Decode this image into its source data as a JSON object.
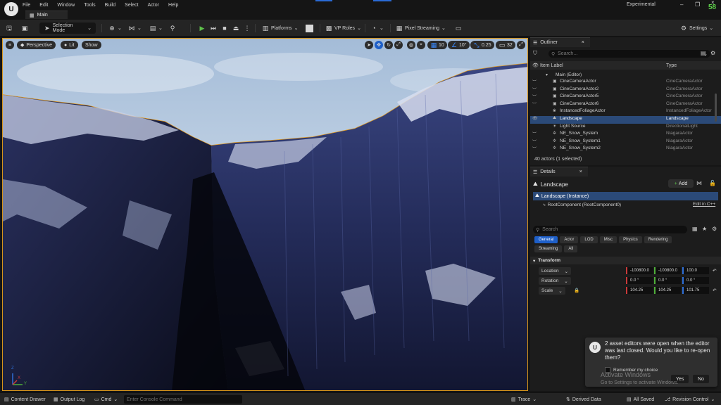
{
  "titlebar": {
    "menus": [
      "File",
      "Edit",
      "Window",
      "Tools",
      "Build",
      "Select",
      "Actor",
      "Help"
    ],
    "tab_label": "Main",
    "experimental": "Experimental",
    "fps": "58"
  },
  "toolbar": {
    "selection_mode": "Selection Mode",
    "platforms": "Platforms",
    "vp_roles": "VP Roles",
    "pixel_streaming": "Pixel Streaming",
    "settings": "Settings"
  },
  "viewport": {
    "perspective": "Perspective",
    "lit": "Lit",
    "show": "Show",
    "grid_snap": "10",
    "rotation_snap": "10°",
    "scale_snap": "0.25",
    "camera_speed": "32",
    "axis_x": "X",
    "axis_y": "Y",
    "axis_z": "Z"
  },
  "outliner": {
    "tab_label": "Outliner",
    "search_placeholder": "Search...",
    "col_label": "Item Label",
    "col_type": "Type",
    "root_label": "Main (Editor)",
    "rows": [
      {
        "label": "CineCameraActor",
        "type": "CineCameraActor",
        "icon": "camera-icon",
        "vis": "︶"
      },
      {
        "label": "CineCameraActor2",
        "type": "CineCameraActor",
        "icon": "camera-icon",
        "vis": "︶"
      },
      {
        "label": "CineCameraActor5",
        "type": "CineCameraActor",
        "icon": "camera-icon",
        "vis": "︶"
      },
      {
        "label": "CineCameraActor6",
        "type": "CineCameraActor",
        "icon": "camera-icon",
        "vis": "︶"
      },
      {
        "label": "InstancedFoliageActor",
        "type": "InstancedFoliageActor",
        "icon": "foliage-icon",
        "vis": ""
      },
      {
        "label": "Landscape",
        "type": "Landscape",
        "icon": "landscape-icon",
        "vis": "👁",
        "selected": true
      },
      {
        "label": "Light Source",
        "type": "DirectionalLight",
        "icon": "light-icon",
        "vis": ""
      },
      {
        "label": "NE_Snow_System",
        "type": "NiagaraActor",
        "icon": "niagara-icon",
        "vis": "︶"
      },
      {
        "label": "NE_Snow_System1",
        "type": "NiagaraActor",
        "icon": "niagara-icon",
        "vis": "︶"
      },
      {
        "label": "NE_Snow_System2",
        "type": "NiagaraActor",
        "icon": "niagara-icon",
        "vis": "︶"
      }
    ],
    "footer": "40 actors (1 selected)"
  },
  "details": {
    "tab_label": "Details",
    "actor_name": "Landscape",
    "add_label": "Add",
    "instance_label": "Landscape (Instance)",
    "root_component": "RootComponent (RootComponent0)",
    "edit_cpp": "Edit in C++",
    "search_placeholder": "Search",
    "categories": [
      "General",
      "Actor",
      "LOD",
      "Misc",
      "Physics",
      "Rendering",
      "Streaming",
      "All"
    ],
    "section": "Transform",
    "location": {
      "label": "Location",
      "x": "-100800.0",
      "y": "-100800.0",
      "z": "100.0"
    },
    "rotation": {
      "label": "Rotation",
      "x": "0.0 °",
      "y": "0.0 °",
      "z": "0.0 °"
    },
    "scale": {
      "label": "Scale",
      "x": "104.25",
      "y": "104.25",
      "z": "101.75"
    }
  },
  "notification": {
    "message": "2 asset editors were open when the editor was last closed. Would you like to re-open them?",
    "remember": "Remember my choice",
    "yes": "Yes",
    "no": "No"
  },
  "watermark": {
    "line1": "Activate Windows",
    "line2": "Go to Settings to activate Windows."
  },
  "statusbar": {
    "content_drawer": "Content Drawer",
    "output_log": "Output Log",
    "cmd": "Cmd",
    "console_placeholder": "Enter Console Command",
    "trace": "Trace",
    "derived_data": "Derived Data",
    "all_saved": "All Saved",
    "revision_control": "Revision Control"
  }
}
